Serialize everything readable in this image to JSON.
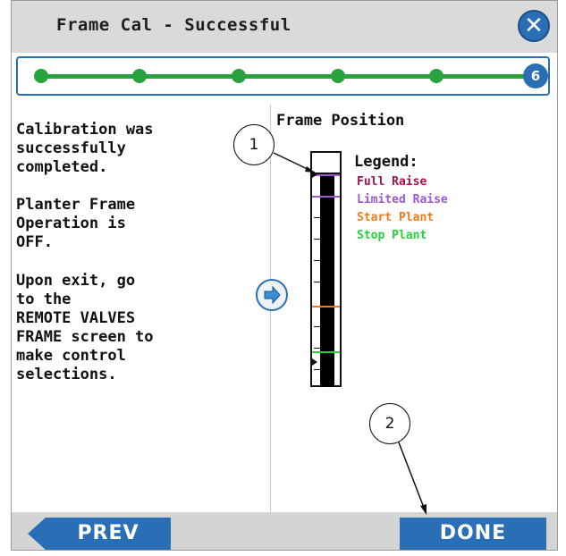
{
  "header": {
    "title": "Frame Cal - Successful",
    "close_icon": "close-icon"
  },
  "progress": {
    "current_step": "6",
    "total_steps": 6,
    "color_complete": "#28a23c",
    "color_current": "#2a6fb5"
  },
  "message": {
    "line1": "Calibration was\nsuccessfully\ncompleted.",
    "line2": "Planter Frame\nOperation is\nOFF.",
    "line3": "Upon exit, go\nto the\nREMOTE VALVES\nFRAME screen to\nmake control\nselections."
  },
  "frame_position": {
    "title": "Frame Position",
    "legend_title": "Legend:",
    "legend": [
      {
        "label": "Full Raise",
        "color": "#a3124f"
      },
      {
        "label": "Limited Raise",
        "color": "#9b59d0"
      },
      {
        "label": "Start Plant",
        "color": "#f07a1a"
      },
      {
        "label": "Stop Plant",
        "color": "#22d33a"
      }
    ]
  },
  "callouts": {
    "one": "1",
    "two": "2"
  },
  "footer": {
    "prev_label": "PREV",
    "done_label": "DONE"
  }
}
